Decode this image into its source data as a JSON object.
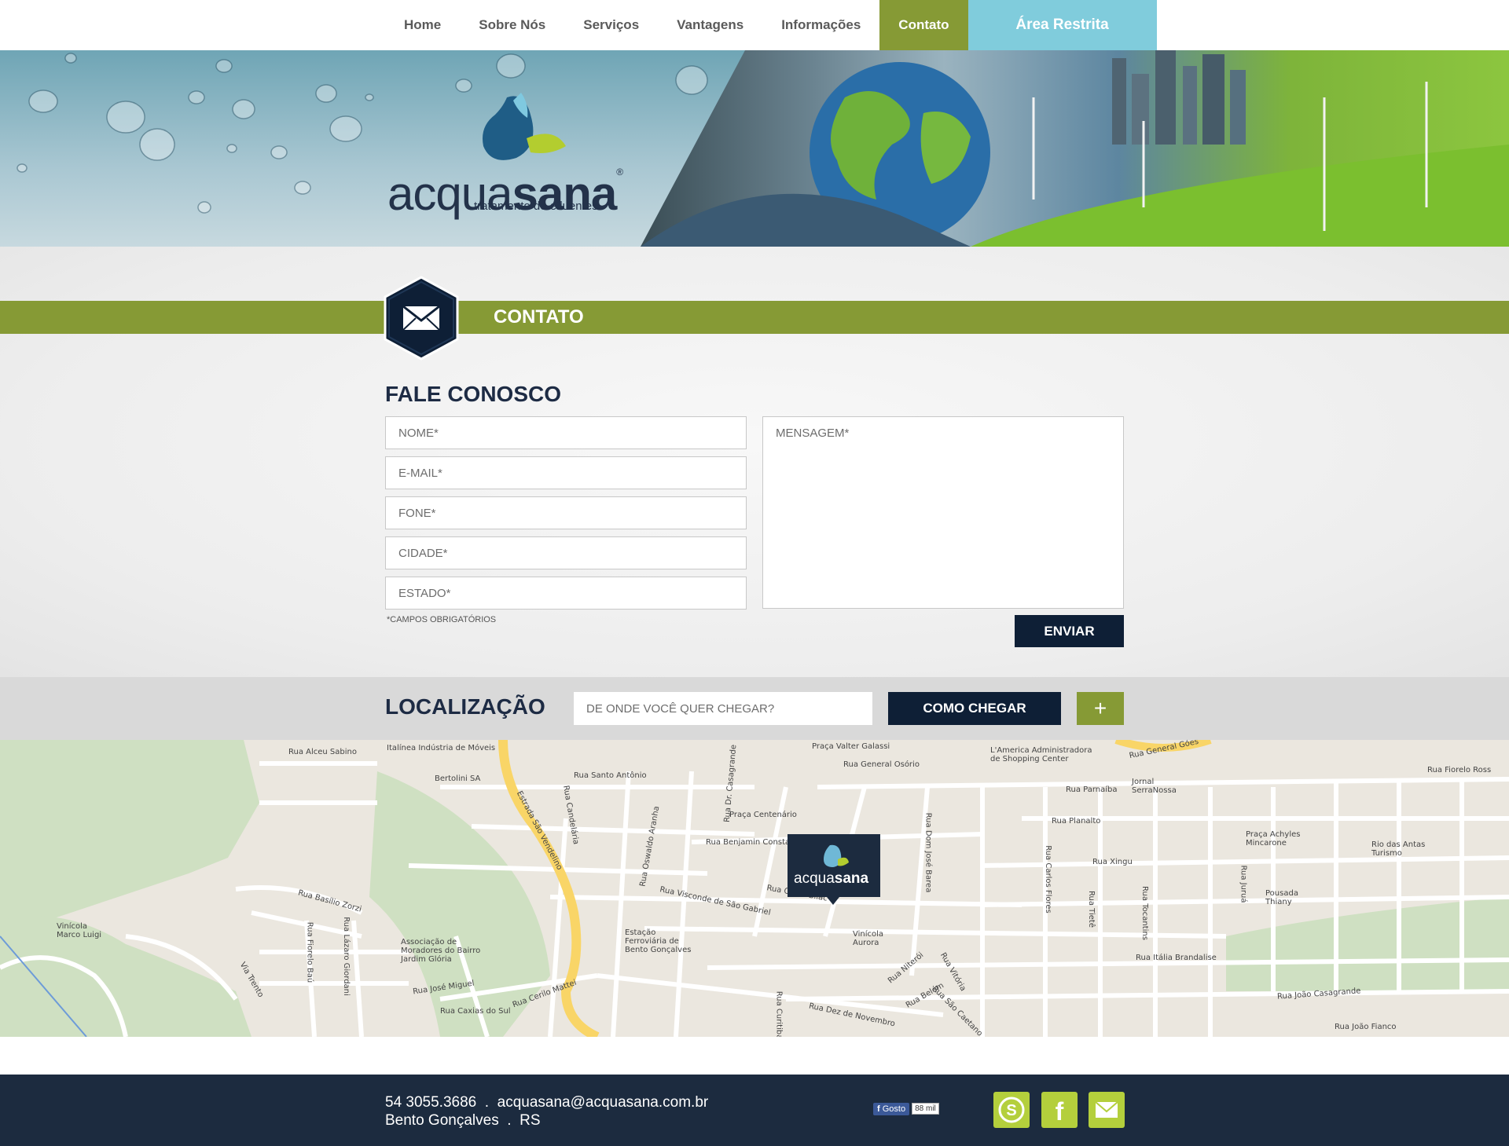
{
  "nav": {
    "items": [
      {
        "label": "Home"
      },
      {
        "label": "Sobre Nós"
      },
      {
        "label": "Serviços"
      },
      {
        "label": "Vantagens"
      },
      {
        "label": "Informações"
      },
      {
        "label": "Contato",
        "active": true
      }
    ],
    "restricted_label": "Área Restrita"
  },
  "brand": {
    "name_light": "acqua",
    "name_bold": "sana",
    "registered": "®",
    "tagline": "tratamento de efluentes"
  },
  "contact": {
    "section_title": "CONTATO",
    "form_title": "FALE CONOSCO",
    "fields": {
      "name_placeholder": "NOME*",
      "email_placeholder": "E-MAIL*",
      "phone_placeholder": "FONE*",
      "city_placeholder": "CIDADE*",
      "state_placeholder": "ESTADO*",
      "message_placeholder": "MENSAGEM*"
    },
    "required_note": "*CAMPOS OBRIGATÓRIOS",
    "submit_label": "ENVIAR"
  },
  "location": {
    "title": "LOCALIZAÇÃO",
    "origin_placeholder": "DE ONDE VOCÊ QUER CHEGAR?",
    "directions_label": "COMO CHEGAR",
    "zoom_label": "+"
  },
  "map": {
    "labels": [
      "Rua Alceu Sabino",
      "Italínea Indústria de Móveis",
      "Bertolini SA",
      "Rua Santo Antônio",
      "Estrada São Vendelino",
      "Rua Candelária",
      "Rua Oswaldo Aranha",
      "Rua Dr. Casagrande",
      "Praça Centenário",
      "Rua Benjamin Constant",
      "Rua Visconde de São Gabriel",
      "Rua Olavo Bilac",
      "Praça Valter Galassi",
      "Rua General Osório",
      "L'America Administradora de Shopping Center",
      "Jornal SerraNossa",
      "Rua Parnaíba",
      "Rua Planalto",
      "Rua Xingu",
      "Praça Achyles Mincarone",
      "Rio das Antas Turismo",
      "Pousada Thiany",
      "Rua Fiorelo Ross",
      "Rua Basílio Zorzi",
      "Vinícola Marco Luigi",
      "Associação de Moradores do Bairro Jardim Glória",
      "Rua José Miguel",
      "Rua Caxias do Sul",
      "Estação Ferroviária de Bento Gonçalves",
      "Vinícola Aurora",
      "Rua Itália Brandalise",
      "Rua João Casagrande",
      "Rua João Fianco",
      "Rua Dez de Novembro",
      "Rua General Góes",
      "Rua Tietê",
      "Rua Tocantins",
      "Rua Juruá",
      "Rua Carlos Flores",
      "Rua Dom José Barea",
      "Rua Lázaro Giordani",
      "Rua Fiorelo Baú",
      "Via Trento",
      "Rua Curitiba",
      "Rua Niterói",
      "Rua Vitória",
      "Rua Belém",
      "Rua São Caetano",
      "Rua Cerilo Mattei"
    ],
    "pin_brand_light": "acqua",
    "pin_brand_bold": "sana"
  },
  "footer": {
    "phone": "54 3055.3686",
    "separator": ".",
    "email": "acquasana@acquasana.com.br",
    "city": "Bento Gonçalves",
    "state": "RS",
    "fb_like_label": "Gosto",
    "fb_like_count": "88 mil",
    "social_icons": [
      "skype-icon",
      "facebook-icon",
      "mail-icon"
    ]
  },
  "colors": {
    "brand_green": "#869a35",
    "brand_navy": "#0e1f36",
    "restricted_blue": "#80ccdc",
    "social_green": "#b4cf3c"
  }
}
